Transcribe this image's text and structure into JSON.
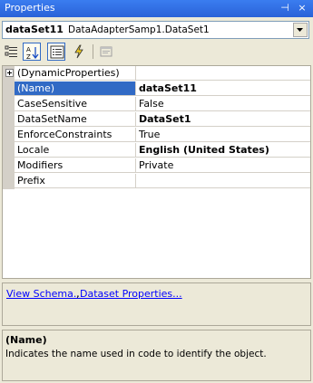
{
  "window": {
    "title": "Properties",
    "pin_glyph": "⊣",
    "close_glyph": "×"
  },
  "object_selector": {
    "name": "dataSet11",
    "type": "DataAdapterSamp1.DataSet1"
  },
  "toolbar": {
    "buttons": [
      {
        "icon": "categorized-icon",
        "active": false
      },
      {
        "icon": "alphabetical-icon",
        "active": true
      },
      {
        "icon": "properties-icon",
        "active": true
      },
      {
        "icon": "events-icon",
        "active": false
      },
      {
        "icon": "property-pages-icon",
        "active": false
      }
    ]
  },
  "properties": [
    {
      "name": "(DynamicProperties)",
      "value": "",
      "expandable": true,
      "bold": false,
      "selected": false
    },
    {
      "name": "(Name)",
      "value": "dataSet11",
      "expandable": false,
      "bold": true,
      "selected": true
    },
    {
      "name": "CaseSensitive",
      "value": "False",
      "expandable": false,
      "bold": false,
      "selected": false
    },
    {
      "name": "DataSetName",
      "value": "DataSet1",
      "expandable": false,
      "bold": true,
      "selected": false
    },
    {
      "name": "EnforceConstraints",
      "value": "True",
      "expandable": false,
      "bold": false,
      "selected": false
    },
    {
      "name": "Locale",
      "value": "English (United States)",
      "expandable": false,
      "bold": true,
      "selected": false
    },
    {
      "name": "Modifiers",
      "value": "Private",
      "expandable": false,
      "bold": false,
      "selected": false
    },
    {
      "name": "Prefix",
      "value": "",
      "expandable": false,
      "bold": false,
      "selected": false
    }
  ],
  "commands": {
    "view_schema": "View Schema...",
    "separator": ",",
    "dataset_properties": "Dataset Properties..."
  },
  "description": {
    "title": "(Name)",
    "text": "Indicates the name used in code to identify the object."
  },
  "colors": {
    "title_bar": "#2a62d8",
    "selection": "#316ac5",
    "link": "#0000ff",
    "panel": "#ece9d8"
  }
}
